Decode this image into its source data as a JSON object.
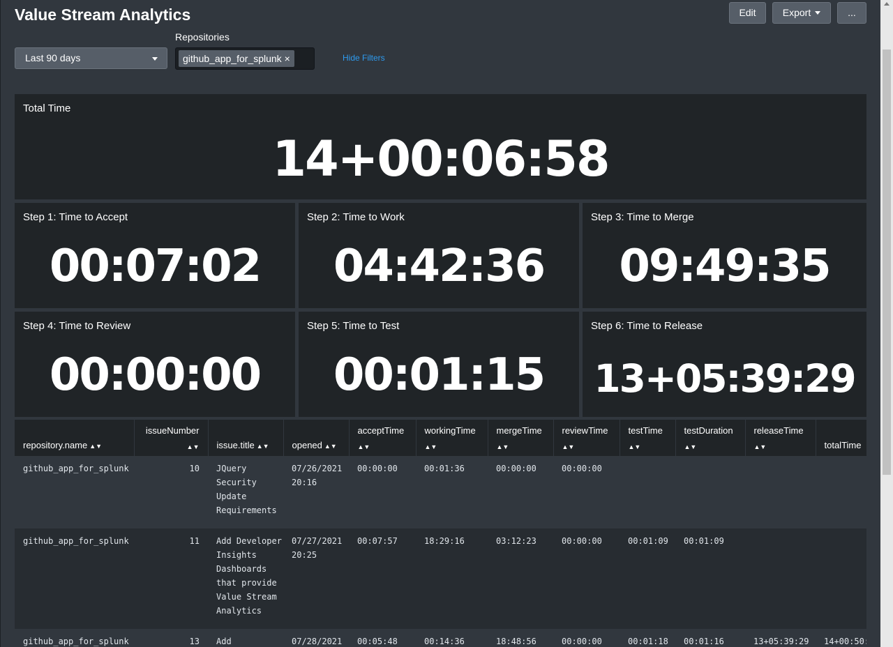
{
  "dashboard": {
    "title": "Value Stream Analytics",
    "edit_label": "Edit",
    "export_label": "Export",
    "more_label": "..."
  },
  "filters": {
    "time_range": "Last 90 days",
    "repositories_label": "Repositories",
    "repositories_selected": [
      "github_app_for_splunk"
    ],
    "chip_remove": "×",
    "hide_filters_label": "Hide Filters"
  },
  "panels": {
    "total": {
      "title": "Total Time",
      "value": "14+00:06:58"
    },
    "steps": [
      {
        "title": "Step 1: Time to Accept",
        "value": "00:07:02"
      },
      {
        "title": "Step 2: Time to Work",
        "value": "04:42:36"
      },
      {
        "title": "Step 3: Time to Merge",
        "value": "09:49:35"
      },
      {
        "title": "Step 4: Time to Review",
        "value": "00:00:00"
      },
      {
        "title": "Step 5: Time to Test",
        "value": "00:01:15"
      },
      {
        "title": "Step 6: Time to Release",
        "value": "13+05:39:29"
      }
    ]
  },
  "table": {
    "sort_glyph": "▲▼",
    "columns": [
      "repository.name",
      "issueNumber",
      "issue.title",
      "opened",
      "acceptTime",
      "workingTime",
      "mergeTime",
      "reviewTime",
      "testTime",
      "testDuration",
      "releaseTime",
      "totalTime"
    ],
    "rows": [
      [
        "github_app_for_splunk",
        "10",
        "JQuery Security Update Requirements",
        "07/26/2021 20:16",
        "00:00:00",
        "00:01:36",
        "00:00:00",
        "00:00:00",
        "",
        "",
        "",
        ""
      ],
      [
        "github_app_for_splunk",
        "11",
        "Add Developer Insights Dashboards that provide Value Stream Analytics",
        "07/27/2021 20:25",
        "00:07:57",
        "18:29:16",
        "03:12:23",
        "00:00:00",
        "00:01:09",
        "00:01:09",
        "",
        ""
      ],
      [
        "github_app_for_splunk",
        "13",
        "Add",
        "07/28/2021",
        "00:05:48",
        "00:14:36",
        "18:48:56",
        "00:00:00",
        "00:01:18",
        "00:01:16",
        "13+05:39:29",
        "14+00:50:"
      ]
    ]
  },
  "colors": {
    "background": "#31373e",
    "panel": "#202427",
    "button": "#565e68",
    "link": "#2e9bef"
  }
}
